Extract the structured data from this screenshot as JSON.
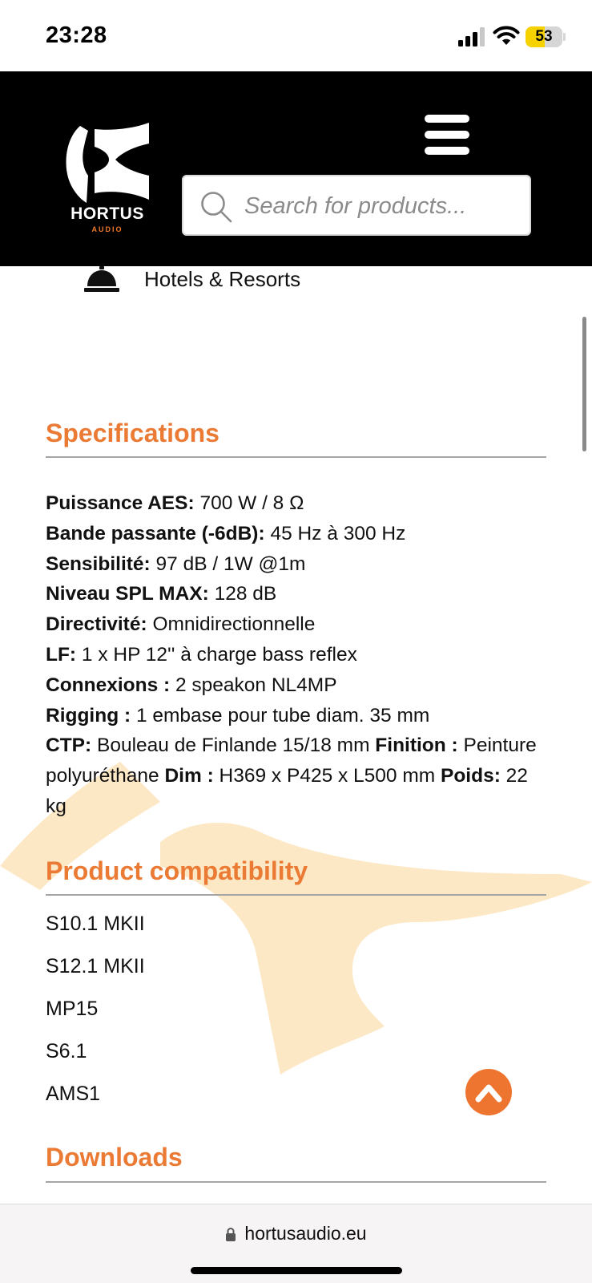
{
  "status_bar": {
    "time": "23:28",
    "battery_level": "53",
    "icons": [
      "cellular-signal-icon",
      "wifi-icon",
      "battery-icon"
    ]
  },
  "header": {
    "logo_text": "HORTUS",
    "logo_subtext": "AUDIO",
    "menu_icon": "hamburger-menu-icon",
    "search": {
      "placeholder": "Search for products..."
    }
  },
  "application_item": {
    "icon": "service-bell-icon",
    "label": "Hotels & Resorts"
  },
  "specifications": {
    "title": "Specifications",
    "items": [
      {
        "label": "Puissance AES:",
        "value": " 700 W / 8 Ω"
      },
      {
        "label": "Bande passante (-6dB):",
        "value": " 45 Hz à 300 Hz"
      },
      {
        "label": "Sensibilité:",
        "value": " 97 dB / 1W @1m"
      },
      {
        "label": "Niveau SPL MAX:",
        "value": " 128 dB"
      },
      {
        "label": "Directivité:",
        "value": " Omnidirectionnelle"
      },
      {
        "label": "LF:",
        "value": " 1 x HP 12'' à charge bass reflex"
      },
      {
        "label": "Connexions :",
        "value": " 2 speakon NL4MP"
      },
      {
        "label": "Rigging :",
        "value": " 1 embase pour tube diam. 35 mm"
      }
    ],
    "inline_items": [
      {
        "label": "CTP:",
        "value": " Bouleau de Finlande 15/18 mm "
      },
      {
        "label": "Finition :",
        "value": " Peinture polyuréthane "
      },
      {
        "label": "Dim :",
        "value": " H369 x P425 x L500 mm "
      },
      {
        "label": "Poids:",
        "value": " 22 kg"
      }
    ]
  },
  "compatibility": {
    "title": "Product compatibility",
    "items": [
      "S10.1 MKII",
      "S12.1 MKII",
      "MP15",
      "S6.1",
      "AMS1"
    ]
  },
  "downloads": {
    "title": "Downloads"
  },
  "back_to_top_icon": "chevron-up-icon",
  "browser": {
    "url": "hortusaudio.eu",
    "lock_icon": "lock-icon"
  },
  "colors": {
    "accent": "#ea7a34",
    "header_bg": "#000000",
    "watermark": "#fde8c6"
  }
}
